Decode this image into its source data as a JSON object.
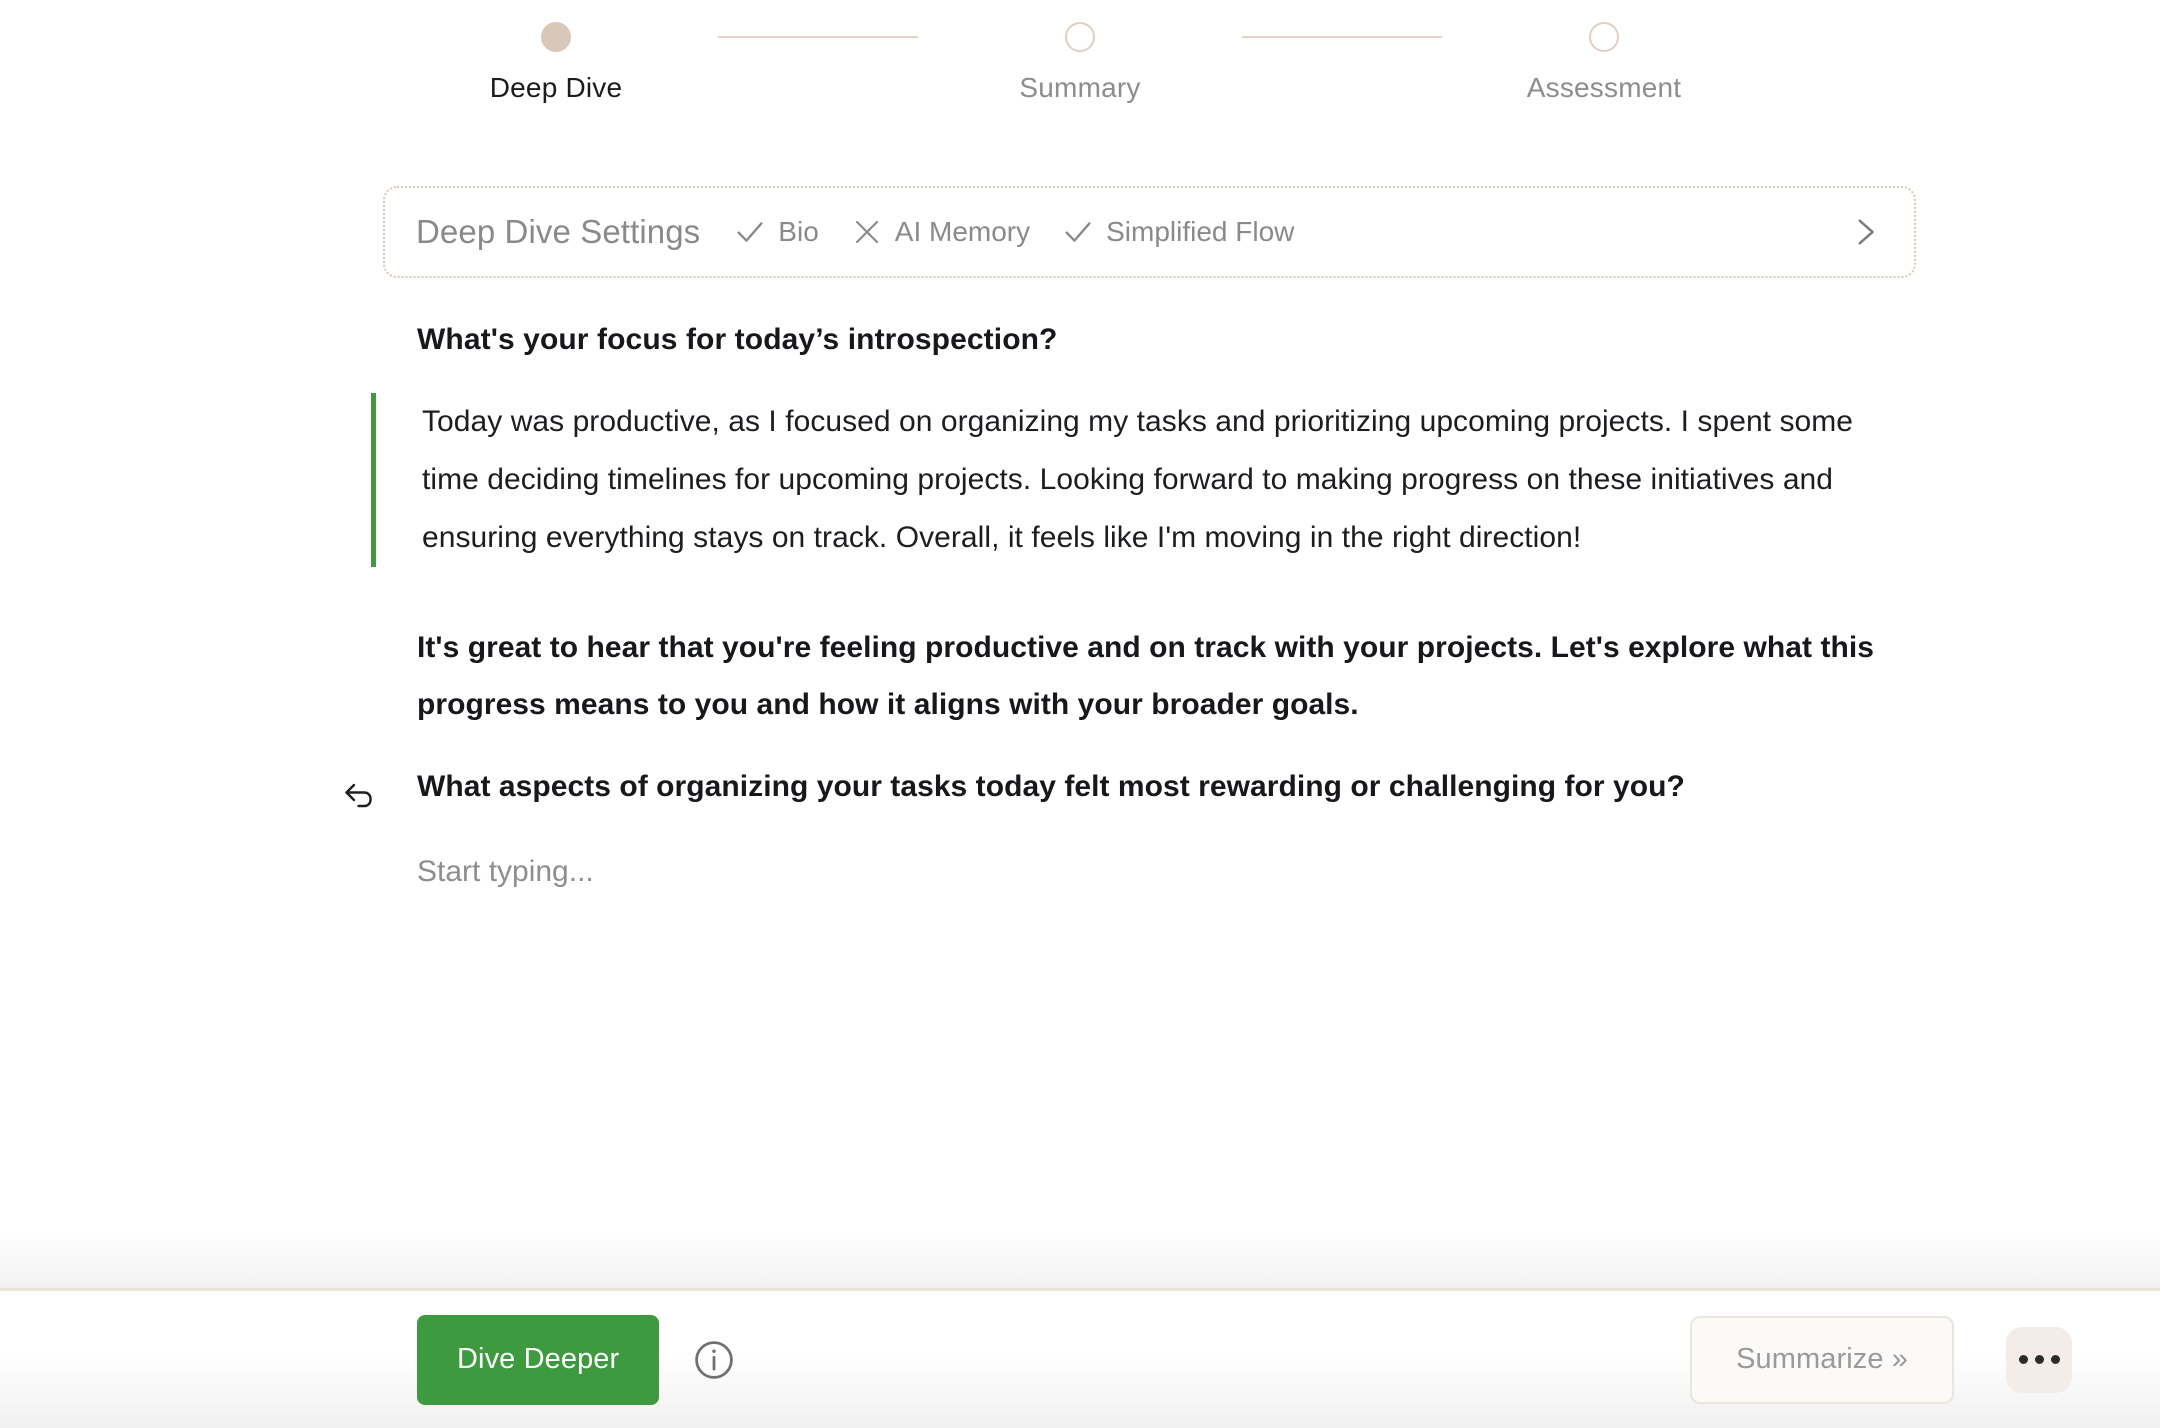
{
  "stepper": {
    "steps": [
      {
        "label": "Deep Dive",
        "state": "active"
      },
      {
        "label": "Summary",
        "state": "pending"
      },
      {
        "label": "Assessment",
        "state": "pending"
      }
    ],
    "active_dot_color": "#d9c8ba",
    "pending_dot_border_color": "#e0cfc2",
    "connector_color": "#e3d3c6"
  },
  "settings": {
    "title": "Deep Dive Settings",
    "flags": [
      {
        "label": "Bio",
        "icon": "check-icon",
        "enabled": true
      },
      {
        "label": "AI Memory",
        "icon": "close-icon",
        "enabled": false
      },
      {
        "label": "Simplified Flow",
        "icon": "check-icon",
        "enabled": true
      }
    ],
    "expand_icon": "chevron-right-icon",
    "border_color": "#ddc7b4"
  },
  "conversation": {
    "prompt_heading": "What's your focus for today’s introspection?",
    "entry": {
      "text": "Today was productive, as I focused on organizing my tasks and prioritizing upcoming projects. I spent some time deciding timelines for upcoming projects. Looking forward to making progress on these initiatives and ensuring everything stays on track. Overall, it feels like I'm moving in the right direction!",
      "accent_color": "#3f9a41"
    },
    "ai_reply": "It's great to hear that you're feeling productive and on track with your projects. Let's explore what this progress means to you and how it aligns with your broader goals.",
    "followup_question": "What aspects of organizing your tasks today felt most rewarding or challenging for you?",
    "followup_icon": "reply-arrow-icon",
    "input_placeholder": "Start typing..."
  },
  "bottom_bar": {
    "primary_action": "Dive Deeper",
    "primary_color": "#3e9a3f",
    "info_icon": "info-circle-icon",
    "secondary_action": "Summarize »",
    "more_icon": "more-horizontal-icon"
  }
}
